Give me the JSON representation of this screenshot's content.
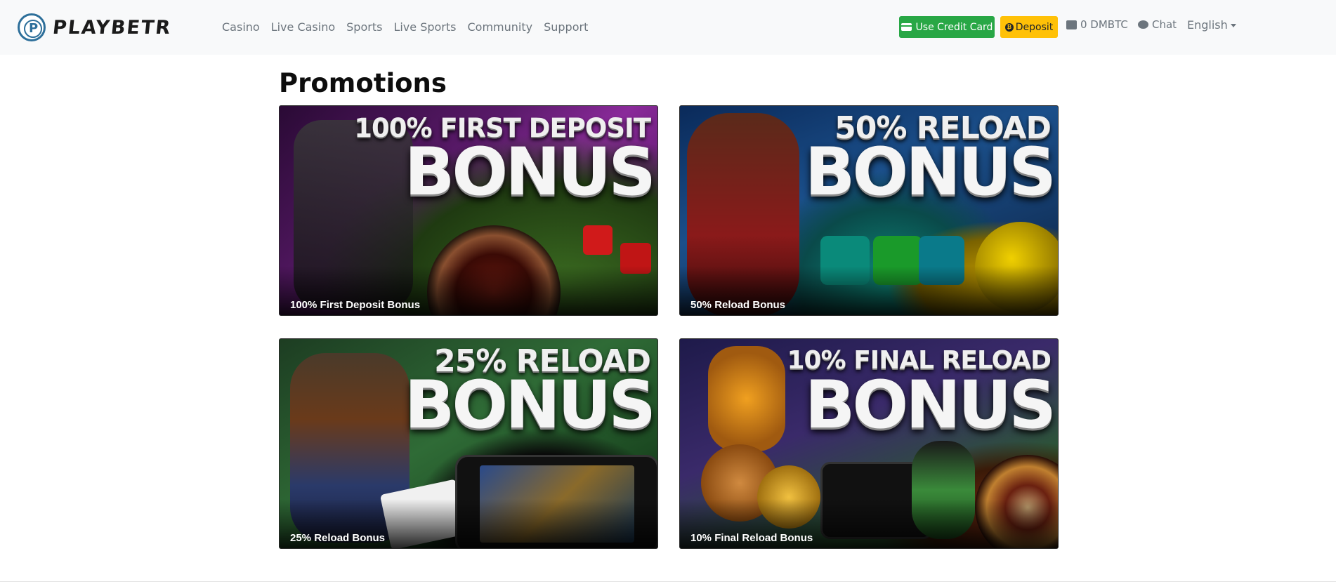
{
  "brand": {
    "name": "PLAYBETR",
    "mark_letter": "P"
  },
  "nav": {
    "links": [
      {
        "label": "Casino"
      },
      {
        "label": "Live Casino"
      },
      {
        "label": "Sports"
      },
      {
        "label": "Live Sports"
      },
      {
        "label": "Community"
      },
      {
        "label": "Support"
      }
    ],
    "use_credit_card": "Use Credit Card",
    "deposit": "Deposit",
    "balance": "0 DMBTC",
    "chat": "Chat",
    "language": "English"
  },
  "page": {
    "title": "Promotions"
  },
  "promotions": [
    {
      "headline_top": "100% FIRST DEPOSIT",
      "headline_big": "BONUS",
      "label": "100% First Deposit Bonus"
    },
    {
      "headline_top": "50% RELOAD",
      "headline_big": "BONUS",
      "label": "50% Reload Bonus"
    },
    {
      "headline_top": "25% RELOAD",
      "headline_big": "BONUS",
      "label": "25% Reload Bonus"
    },
    {
      "headline_top": "10% FINAL RELOAD",
      "headline_big": "BONUS",
      "label": "10% Final Reload Bonus"
    }
  ],
  "colors": {
    "navbar_bg": "#f8f9fa",
    "credit_card_button": "#28a745",
    "deposit_button": "#ffc107",
    "nav_text": "#6c757d",
    "brand_accent": "#2d6f9a"
  },
  "icons": {
    "credit_card": "credit-card-icon",
    "deposit": "bitcoin-icon",
    "wallet": "wallet-icon",
    "chat": "chat-icon",
    "dropdown": "caret-down-icon"
  }
}
